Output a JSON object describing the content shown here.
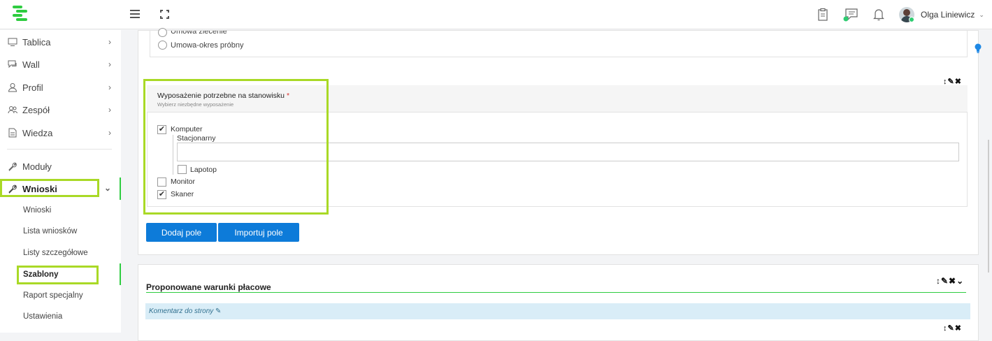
{
  "header": {
    "user_name": "Olga Liniewicz",
    "user_caret": "⌄"
  },
  "sidebar": {
    "items": [
      {
        "label": "Tablica",
        "icon": "monitor-icon"
      },
      {
        "label": "Wall",
        "icon": "chat-icon"
      },
      {
        "label": "Profil",
        "icon": "user-icon"
      },
      {
        "label": "Zespół",
        "icon": "team-icon"
      },
      {
        "label": "Wiedza",
        "icon": "document-icon"
      },
      {
        "label": "Moduły",
        "icon": "wrench-icon"
      },
      {
        "label": "Wnioski",
        "icon": "wrench-icon"
      }
    ],
    "chevron_right": "›",
    "chevron_down": "⌄",
    "sub_items": [
      "Wnioski",
      "Lista wniosków",
      "Listy szczegółowe",
      "Szablony",
      "Raport specjalny",
      "Ustawienia"
    ],
    "accent_color": "#2ecc40",
    "highlight_color": "#a9d926"
  },
  "form": {
    "radio_options": [
      "Umowa zlecenie",
      "Umowa-okres próbny"
    ],
    "field": {
      "title": "Wyposażenie potrzebne na stanowisku",
      "required_mark": "*",
      "help": "Wybierz niezbędne wyposażenie",
      "options": [
        {
          "label": "Komputer",
          "checked": true
        },
        {
          "label": "Lapotop",
          "checked": false
        },
        {
          "label": "Monitor",
          "checked": false
        },
        {
          "label": "Skaner",
          "checked": true
        }
      ],
      "sub_label": "Stacjonarny",
      "sub_input_value": ""
    },
    "controls_icons": "↕✎✖",
    "add_field_button": "Dodaj pole",
    "import_field_button": "Importuj pole",
    "button_color": "#0d7bd9"
  },
  "section": {
    "title": "Proponowane warunki płacowe",
    "controls_icons": "↕✎✖⌄",
    "comment": "Komentarz do strony",
    "comment_icon": "edit-icon",
    "bottom_controls": "↕✎✖"
  }
}
